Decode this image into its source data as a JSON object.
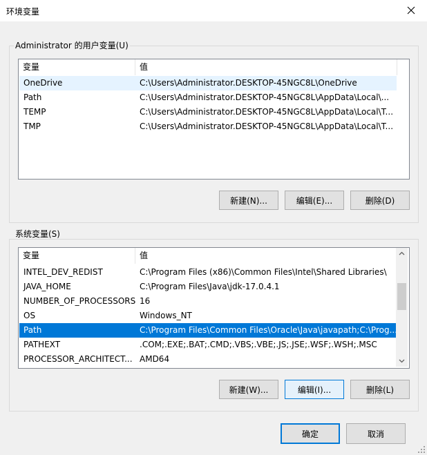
{
  "window": {
    "title": "环境变量"
  },
  "user_vars": {
    "group_label": "Administrator 的用户变量(U)",
    "col_name": "变量",
    "col_value": "值",
    "rows": [
      {
        "name": "OneDrive",
        "value": "C:\\Users\\Administrator.DESKTOP-45NGC8L\\OneDrive"
      },
      {
        "name": "Path",
        "value": "C:\\Users\\Administrator.DESKTOP-45NGC8L\\AppData\\Local\\..."
      },
      {
        "name": "TEMP",
        "value": "C:\\Users\\Administrator.DESKTOP-45NGC8L\\AppData\\Local\\T..."
      },
      {
        "name": "TMP",
        "value": "C:\\Users\\Administrator.DESKTOP-45NGC8L\\AppData\\Local\\T..."
      }
    ],
    "buttons": {
      "new": "新建(N)...",
      "edit": "编辑(E)...",
      "delete": "删除(D)"
    }
  },
  "system_vars": {
    "group_label": "系统变量(S)",
    "col_name": "变量",
    "col_value": "值",
    "rows": [
      {
        "name": "INTEL_DEV_REDIST",
        "value": "C:\\Program Files (x86)\\Common Files\\Intel\\Shared Libraries\\"
      },
      {
        "name": "JAVA_HOME",
        "value": "C:\\Program Files\\Java\\jdk-17.0.4.1"
      },
      {
        "name": "NUMBER_OF_PROCESSORS",
        "value": "16"
      },
      {
        "name": "OS",
        "value": "Windows_NT"
      },
      {
        "name": "Path",
        "value": "C:\\Program Files\\Common Files\\Oracle\\Java\\javapath;C:\\Prog..."
      },
      {
        "name": "PATHEXT",
        "value": ".COM;.EXE;.BAT;.CMD;.VBS;.VBE;.JS;.JSE;.WSF;.WSH;.MSC"
      },
      {
        "name": "PROCESSOR_ARCHITECT...",
        "value": "AMD64"
      }
    ],
    "buttons": {
      "new": "新建(W)...",
      "edit": "编辑(I)...",
      "delete": "删除(L)"
    }
  },
  "footer": {
    "ok": "确定",
    "cancel": "取消"
  },
  "colors": {
    "selection": "#0078d7",
    "hover": "#e5f3ff",
    "focus_border": "#0078d7"
  }
}
